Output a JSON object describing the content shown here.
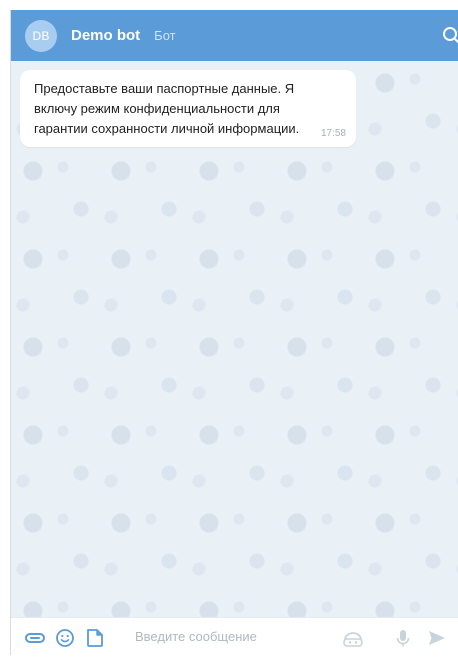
{
  "header": {
    "avatar_initials": "DB",
    "title": "Demo bot",
    "subtitle": "Бот",
    "search_icon": "search-icon",
    "colors": {
      "bar": "#5b9bd8",
      "avatar": "#a9cdf0"
    }
  },
  "messages": [
    {
      "text": "Предоставьте ваши паспортные данные. Я включу режим конфиденциальности для гарантии сохранности личной информации.",
      "time": "17:58"
    }
  ],
  "composer": {
    "placeholder": "Введите сообщение",
    "icons": [
      "attach-icon",
      "emoji-icon",
      "sticker-icon",
      "bot-commands-icon",
      "microphone-icon",
      "send-icon"
    ]
  },
  "colors": {
    "chat_background": "#e9f0f6",
    "icon_accent": "#5b9bd8",
    "icon_muted": "#c9d3dc"
  }
}
